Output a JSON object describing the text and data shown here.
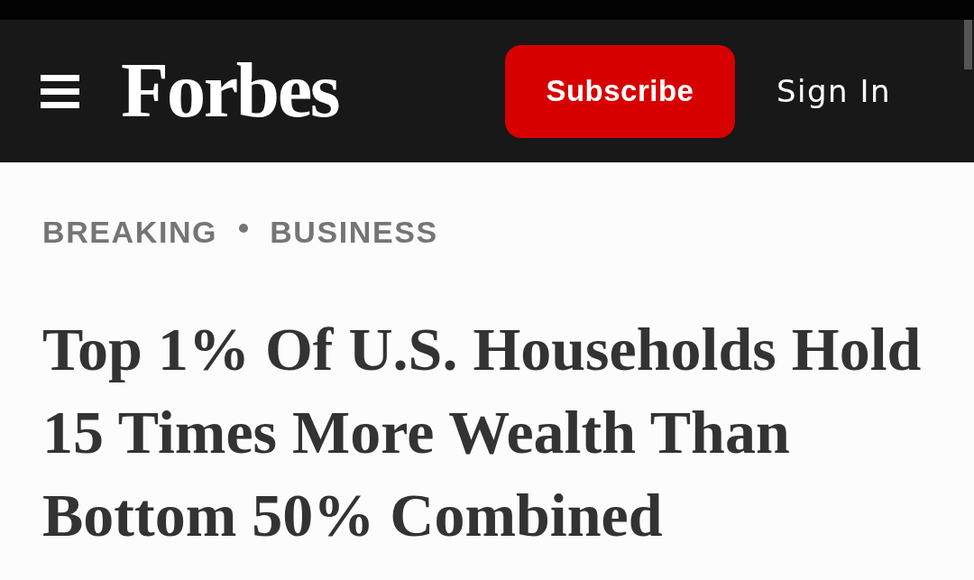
{
  "header": {
    "logo": "Forbes",
    "subscribe_button": "Subscribe",
    "sign_in_link": "Sign In"
  },
  "article": {
    "breadcrumb": [
      "BREAKING",
      "BUSINESS"
    ],
    "headline": "Top 1% Of U.S. Households Hold 15 Times More Wealth Than Bottom 50% Combined"
  }
}
